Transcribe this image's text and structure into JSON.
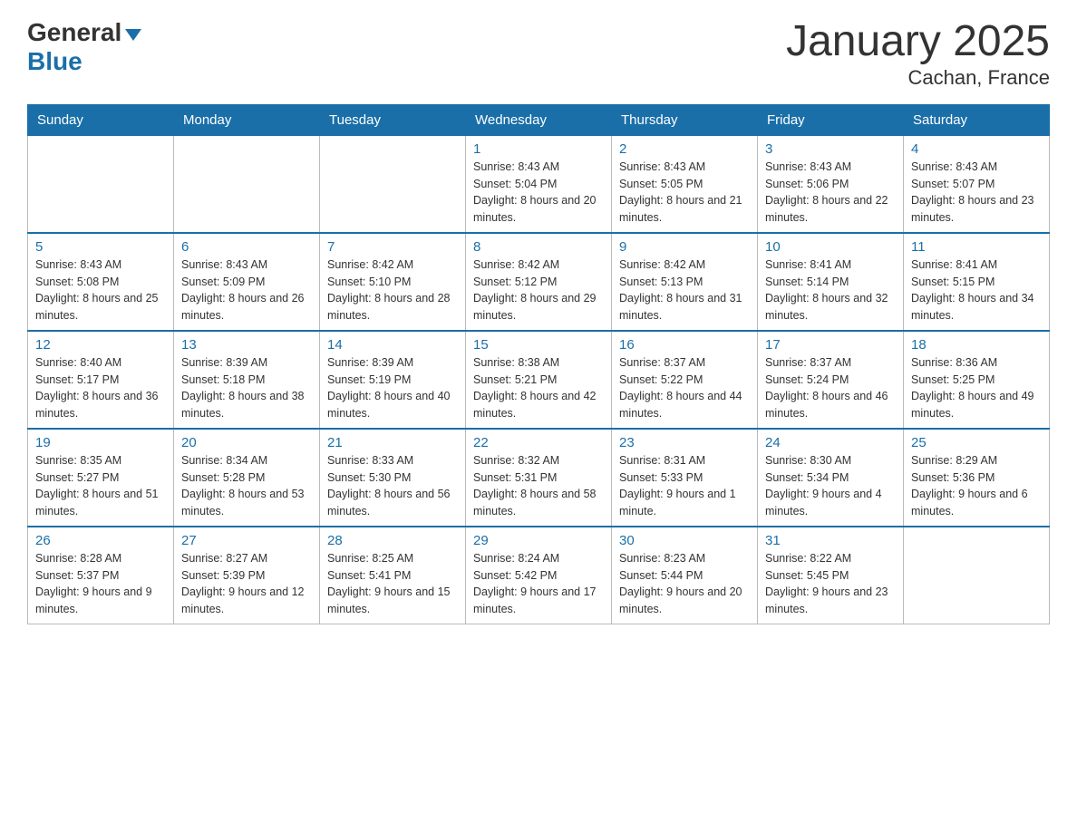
{
  "header": {
    "logo_general": "General",
    "logo_blue": "Blue",
    "title": "January 2025",
    "subtitle": "Cachan, France"
  },
  "days_of_week": [
    "Sunday",
    "Monday",
    "Tuesday",
    "Wednesday",
    "Thursday",
    "Friday",
    "Saturday"
  ],
  "weeks": [
    [
      {
        "day": "",
        "sunrise": "",
        "sunset": "",
        "daylight": ""
      },
      {
        "day": "",
        "sunrise": "",
        "sunset": "",
        "daylight": ""
      },
      {
        "day": "",
        "sunrise": "",
        "sunset": "",
        "daylight": ""
      },
      {
        "day": "1",
        "sunrise": "Sunrise: 8:43 AM",
        "sunset": "Sunset: 5:04 PM",
        "daylight": "Daylight: 8 hours and 20 minutes."
      },
      {
        "day": "2",
        "sunrise": "Sunrise: 8:43 AM",
        "sunset": "Sunset: 5:05 PM",
        "daylight": "Daylight: 8 hours and 21 minutes."
      },
      {
        "day": "3",
        "sunrise": "Sunrise: 8:43 AM",
        "sunset": "Sunset: 5:06 PM",
        "daylight": "Daylight: 8 hours and 22 minutes."
      },
      {
        "day": "4",
        "sunrise": "Sunrise: 8:43 AM",
        "sunset": "Sunset: 5:07 PM",
        "daylight": "Daylight: 8 hours and 23 minutes."
      }
    ],
    [
      {
        "day": "5",
        "sunrise": "Sunrise: 8:43 AM",
        "sunset": "Sunset: 5:08 PM",
        "daylight": "Daylight: 8 hours and 25 minutes."
      },
      {
        "day": "6",
        "sunrise": "Sunrise: 8:43 AM",
        "sunset": "Sunset: 5:09 PM",
        "daylight": "Daylight: 8 hours and 26 minutes."
      },
      {
        "day": "7",
        "sunrise": "Sunrise: 8:42 AM",
        "sunset": "Sunset: 5:10 PM",
        "daylight": "Daylight: 8 hours and 28 minutes."
      },
      {
        "day": "8",
        "sunrise": "Sunrise: 8:42 AM",
        "sunset": "Sunset: 5:12 PM",
        "daylight": "Daylight: 8 hours and 29 minutes."
      },
      {
        "day": "9",
        "sunrise": "Sunrise: 8:42 AM",
        "sunset": "Sunset: 5:13 PM",
        "daylight": "Daylight: 8 hours and 31 minutes."
      },
      {
        "day": "10",
        "sunrise": "Sunrise: 8:41 AM",
        "sunset": "Sunset: 5:14 PM",
        "daylight": "Daylight: 8 hours and 32 minutes."
      },
      {
        "day": "11",
        "sunrise": "Sunrise: 8:41 AM",
        "sunset": "Sunset: 5:15 PM",
        "daylight": "Daylight: 8 hours and 34 minutes."
      }
    ],
    [
      {
        "day": "12",
        "sunrise": "Sunrise: 8:40 AM",
        "sunset": "Sunset: 5:17 PM",
        "daylight": "Daylight: 8 hours and 36 minutes."
      },
      {
        "day": "13",
        "sunrise": "Sunrise: 8:39 AM",
        "sunset": "Sunset: 5:18 PM",
        "daylight": "Daylight: 8 hours and 38 minutes."
      },
      {
        "day": "14",
        "sunrise": "Sunrise: 8:39 AM",
        "sunset": "Sunset: 5:19 PM",
        "daylight": "Daylight: 8 hours and 40 minutes."
      },
      {
        "day": "15",
        "sunrise": "Sunrise: 8:38 AM",
        "sunset": "Sunset: 5:21 PM",
        "daylight": "Daylight: 8 hours and 42 minutes."
      },
      {
        "day": "16",
        "sunrise": "Sunrise: 8:37 AM",
        "sunset": "Sunset: 5:22 PM",
        "daylight": "Daylight: 8 hours and 44 minutes."
      },
      {
        "day": "17",
        "sunrise": "Sunrise: 8:37 AM",
        "sunset": "Sunset: 5:24 PM",
        "daylight": "Daylight: 8 hours and 46 minutes."
      },
      {
        "day": "18",
        "sunrise": "Sunrise: 8:36 AM",
        "sunset": "Sunset: 5:25 PM",
        "daylight": "Daylight: 8 hours and 49 minutes."
      }
    ],
    [
      {
        "day": "19",
        "sunrise": "Sunrise: 8:35 AM",
        "sunset": "Sunset: 5:27 PM",
        "daylight": "Daylight: 8 hours and 51 minutes."
      },
      {
        "day": "20",
        "sunrise": "Sunrise: 8:34 AM",
        "sunset": "Sunset: 5:28 PM",
        "daylight": "Daylight: 8 hours and 53 minutes."
      },
      {
        "day": "21",
        "sunrise": "Sunrise: 8:33 AM",
        "sunset": "Sunset: 5:30 PM",
        "daylight": "Daylight: 8 hours and 56 minutes."
      },
      {
        "day": "22",
        "sunrise": "Sunrise: 8:32 AM",
        "sunset": "Sunset: 5:31 PM",
        "daylight": "Daylight: 8 hours and 58 minutes."
      },
      {
        "day": "23",
        "sunrise": "Sunrise: 8:31 AM",
        "sunset": "Sunset: 5:33 PM",
        "daylight": "Daylight: 9 hours and 1 minute."
      },
      {
        "day": "24",
        "sunrise": "Sunrise: 8:30 AM",
        "sunset": "Sunset: 5:34 PM",
        "daylight": "Daylight: 9 hours and 4 minutes."
      },
      {
        "day": "25",
        "sunrise": "Sunrise: 8:29 AM",
        "sunset": "Sunset: 5:36 PM",
        "daylight": "Daylight: 9 hours and 6 minutes."
      }
    ],
    [
      {
        "day": "26",
        "sunrise": "Sunrise: 8:28 AM",
        "sunset": "Sunset: 5:37 PM",
        "daylight": "Daylight: 9 hours and 9 minutes."
      },
      {
        "day": "27",
        "sunrise": "Sunrise: 8:27 AM",
        "sunset": "Sunset: 5:39 PM",
        "daylight": "Daylight: 9 hours and 12 minutes."
      },
      {
        "day": "28",
        "sunrise": "Sunrise: 8:25 AM",
        "sunset": "Sunset: 5:41 PM",
        "daylight": "Daylight: 9 hours and 15 minutes."
      },
      {
        "day": "29",
        "sunrise": "Sunrise: 8:24 AM",
        "sunset": "Sunset: 5:42 PM",
        "daylight": "Daylight: 9 hours and 17 minutes."
      },
      {
        "day": "30",
        "sunrise": "Sunrise: 8:23 AM",
        "sunset": "Sunset: 5:44 PM",
        "daylight": "Daylight: 9 hours and 20 minutes."
      },
      {
        "day": "31",
        "sunrise": "Sunrise: 8:22 AM",
        "sunset": "Sunset: 5:45 PM",
        "daylight": "Daylight: 9 hours and 23 minutes."
      },
      {
        "day": "",
        "sunrise": "",
        "sunset": "",
        "daylight": ""
      }
    ]
  ]
}
